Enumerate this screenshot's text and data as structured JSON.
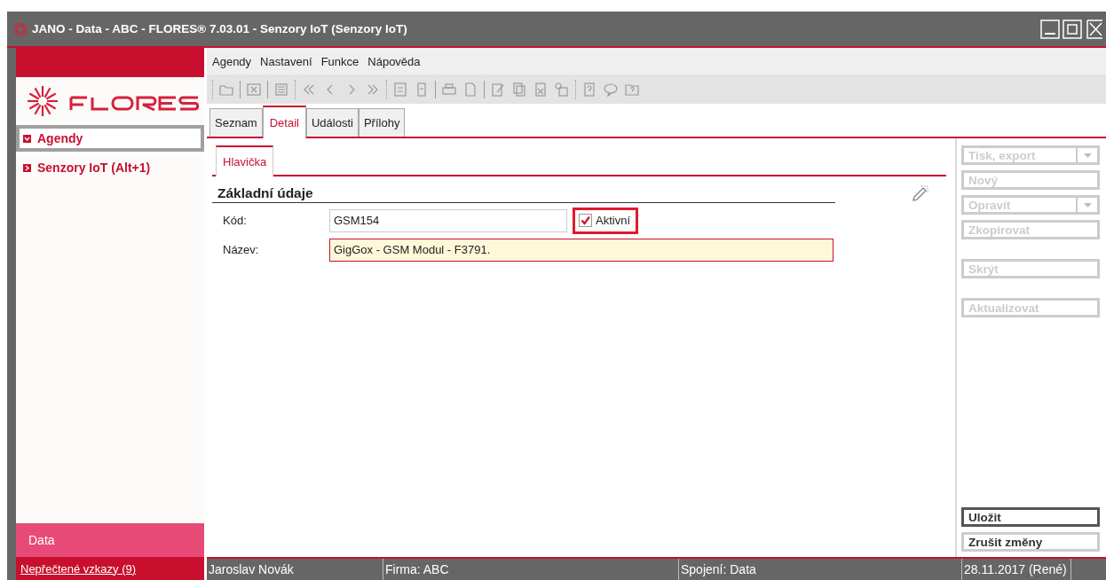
{
  "window": {
    "title": "JANO - Data - ABC - FLORES® 7.03.01 - Senzory IoT  (Senzory IoT)"
  },
  "sidebar": {
    "items": [
      {
        "label": "Agendy",
        "selected": true,
        "expanded": true
      },
      {
        "label": "Senzory IoT (Alt+1)",
        "selected": false,
        "expanded": false
      }
    ],
    "footer_label": "Data",
    "messages_link": "Nepřečtené vzkazy (9)"
  },
  "menu": [
    "Agendy",
    "Nastavení",
    "Funkce",
    "Nápověda"
  ],
  "tabs": [
    {
      "label": "Seznam",
      "selected": false
    },
    {
      "label": "Detail",
      "selected": true
    },
    {
      "label": "Události",
      "selected": false
    },
    {
      "label": "Přílohy",
      "selected": false
    }
  ],
  "subtabs": [
    {
      "label": "Hlavička",
      "selected": true
    }
  ],
  "section": {
    "title": "Základní údaje"
  },
  "fields": [
    {
      "label": "Kód:",
      "value": "GSM154",
      "required": false,
      "checkbox": {
        "label": "Aktivní",
        "checked": true,
        "highlighted": true
      }
    },
    {
      "label": "Název:",
      "value": "GigGox - GSM Modul - F3791.",
      "required": true
    }
  ],
  "actions": [
    [
      {
        "label": "Tisk, export",
        "kind": "dropdown",
        "disabled": true
      },
      {
        "label": "Nový",
        "kind": "button",
        "disabled": true
      },
      {
        "label": "Opravit",
        "kind": "dropdown",
        "disabled": true
      },
      {
        "label": "Zkopírovat",
        "kind": "button",
        "disabled": true
      }
    ],
    [
      {
        "label": "Skrýt",
        "kind": "button",
        "disabled": true
      }
    ],
    [
      {
        "label": "Aktualizovat",
        "kind": "button",
        "disabled": true
      }
    ]
  ],
  "bottom_actions": [
    {
      "label": "Uložit",
      "default": true
    },
    {
      "label": "Zrušit změny",
      "default": false
    }
  ],
  "status_bar": [
    "Jaroslav Novák",
    "Firma: ABC",
    "Spojení: Data",
    "28.11.2017 (René)"
  ]
}
